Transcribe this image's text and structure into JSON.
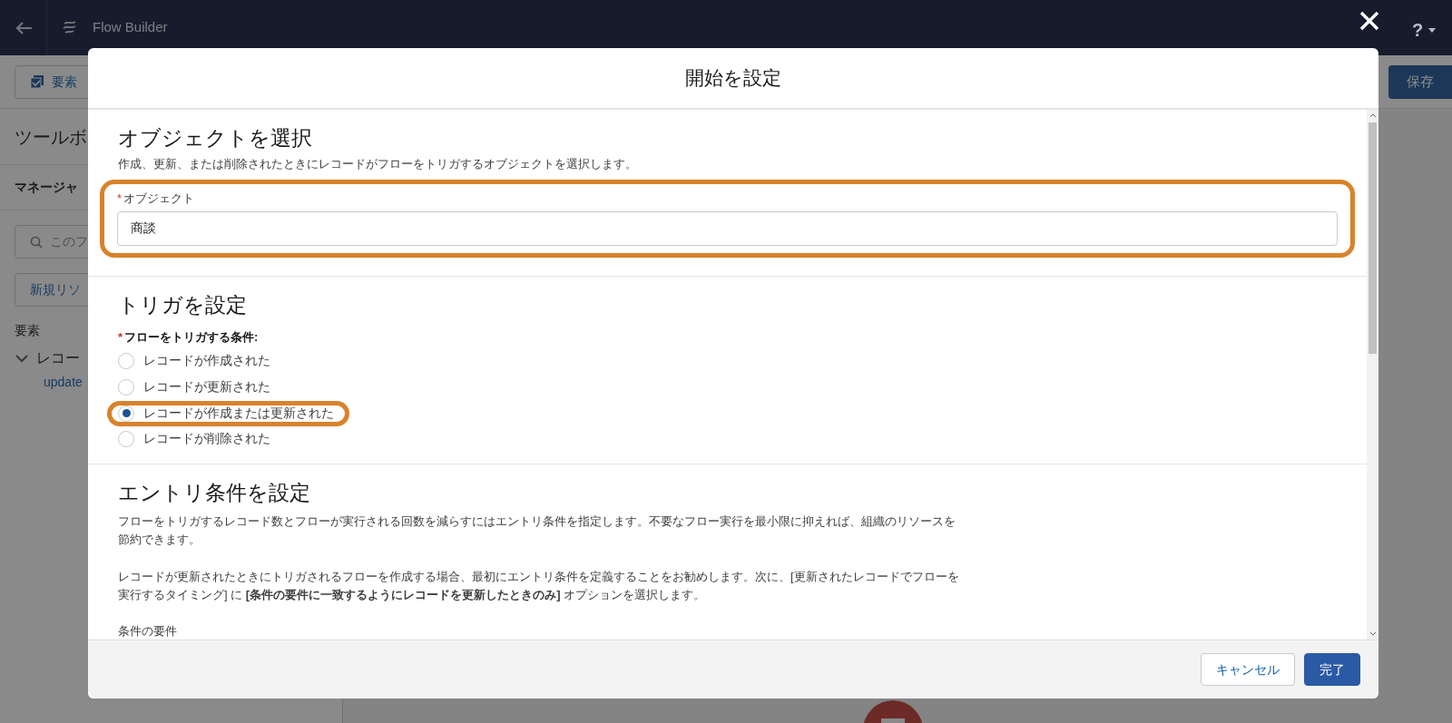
{
  "app": {
    "title": "Flow Builder",
    "help": "?"
  },
  "background": {
    "toolbar_button": "要素",
    "save_button": "保存",
    "toolbox_title": "ツールボ",
    "tab": "マネージャ",
    "search_placeholder": "このフ",
    "new_resource_button": "新規リソ",
    "elements_heading": "要素",
    "tree": [
      {
        "label": "レコー",
        "expanded": true,
        "children": [
          {
            "label": "update"
          }
        ]
      }
    ]
  },
  "modal": {
    "title": "開始を設定",
    "sections": [
      {
        "kind": "object",
        "heading": "オブジェクトを選択",
        "description": "作成、更新、または削除されたときにレコードがフローをトリガするオブジェクトを選択します。",
        "field": {
          "label": "オブジェクト",
          "required_mark": "*",
          "value": "商談",
          "highlighted": true
        }
      },
      {
        "kind": "trigger",
        "heading": "トリガを設定",
        "group_label": "フローをトリガする条件:",
        "required_mark": "*",
        "options": [
          {
            "label": "レコードが作成された",
            "selected": false,
            "highlighted": false
          },
          {
            "label": "レコードが更新された",
            "selected": false,
            "highlighted": false
          },
          {
            "label": "レコードが作成または更新された",
            "selected": true,
            "highlighted": true
          },
          {
            "label": "レコードが削除された",
            "selected": false,
            "highlighted": false
          }
        ]
      },
      {
        "kind": "entry",
        "heading": "エントリ条件を設定",
        "paragraphs": [
          "フローをトリガするレコード数とフローが実行される回数を減らすにはエントリ条件を指定します。不要なフロー実行を最小限に抑えれば、組織のリソースを節約できます。",
          "レコードが更新されたときにトリガされるフローを作成する場合、最初にエントリ条件を定義することをお勧めします。次に、[更新されたレコードでフローを実行するタイミング] に **[条件の要件に一致するようにレコードを更新したときのみ]** オプションを選択します。"
        ],
        "subheading": "条件の要件"
      }
    ],
    "buttons": [
      {
        "label": "キャンセル",
        "kind": "neutral"
      },
      {
        "label": "完了",
        "kind": "brand"
      }
    ]
  }
}
